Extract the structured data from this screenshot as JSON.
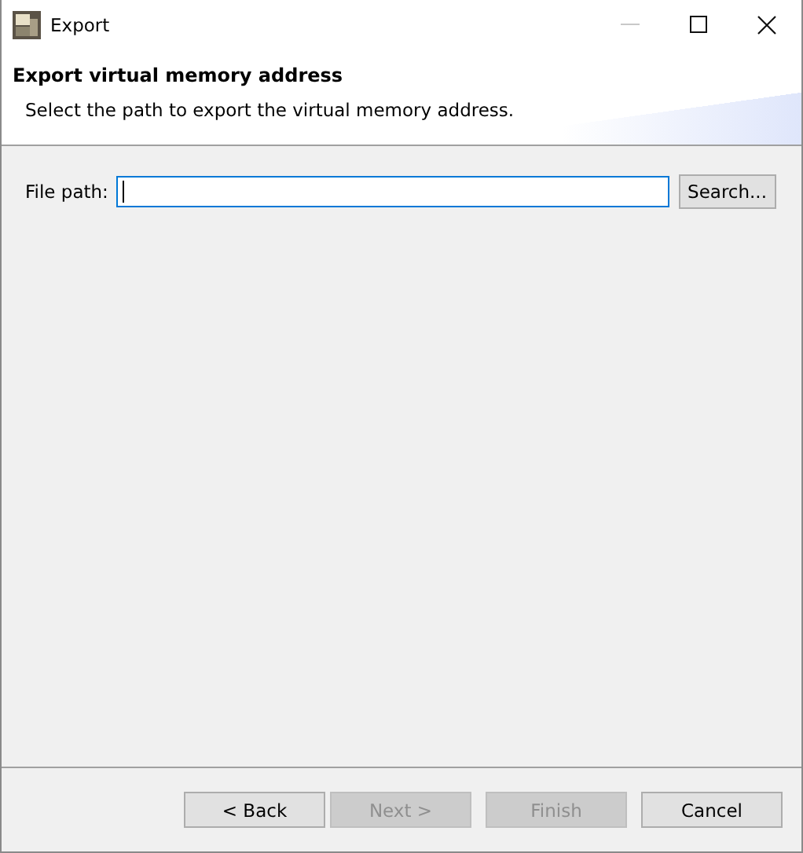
{
  "window": {
    "title": "Export"
  },
  "header": {
    "title": "Export virtual memory address",
    "description": "Select the path to export the virtual memory address."
  },
  "file_path": {
    "label": "File path:",
    "button": "Search..."
  },
  "buttons": [
    {
      "label": "< Back",
      "disabled": false
    },
    {
      "label": "Next >",
      "disabled": true
    },
    {
      "label": "Finish",
      "disabled": true
    },
    {
      "label": "Cancel",
      "disabled": false
    }
  ]
}
